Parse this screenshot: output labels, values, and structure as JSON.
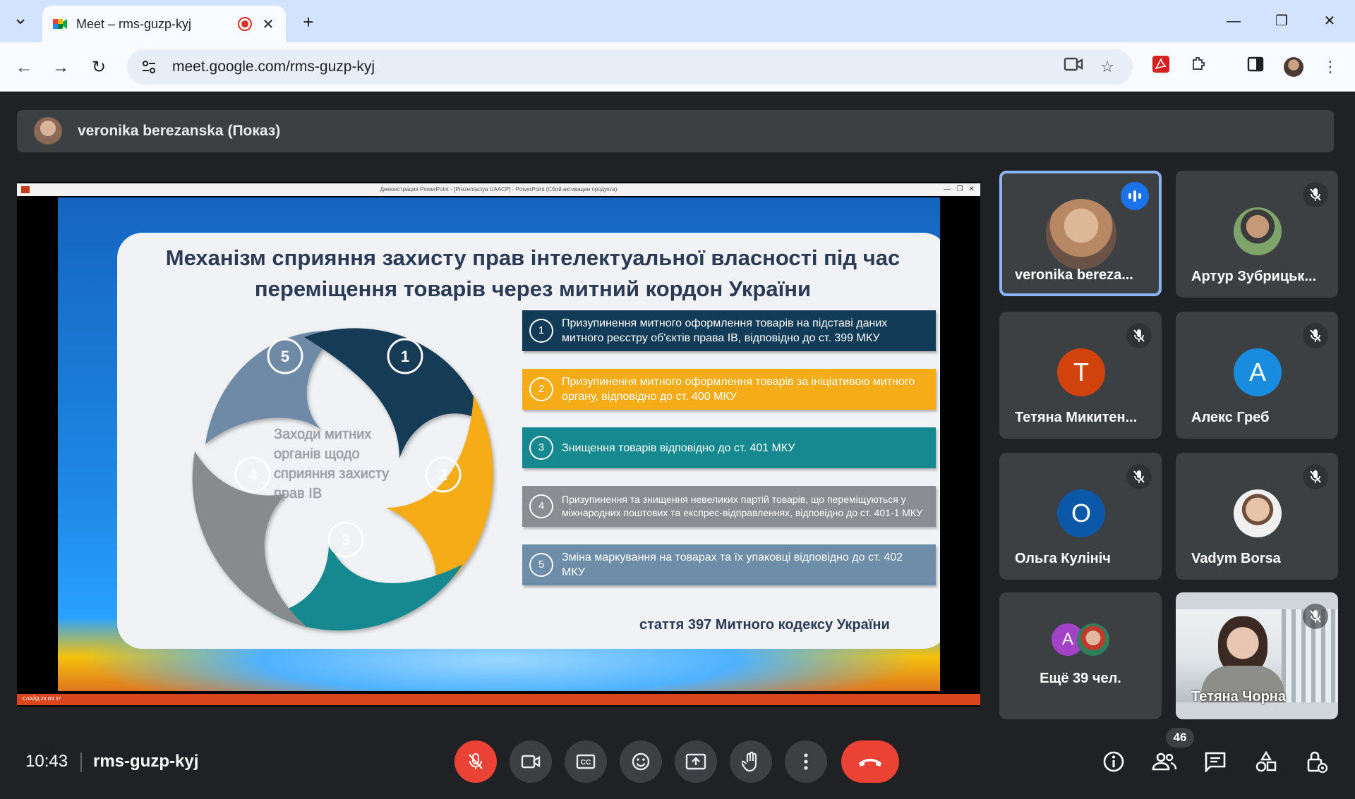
{
  "browser": {
    "tab_title": "Meet – rms-guzp-kyj",
    "url": "meet.google.com/rms-guzp-kyj"
  },
  "banner": {
    "presenter": "veronika berezanska (Показ)"
  },
  "slide": {
    "window_title": "Демонстрация PowerPoint - [Prezentaciya UAACP] - PowerPoint (Сбой активации продукта)",
    "title_line1": "Механізм сприяння захисту прав інтелектуальної власності під час",
    "title_line2": "переміщення товарів через митний кордон України",
    "cycle_center": "Заходи митних органів щодо сприяння захисту прав ІВ",
    "cycle_numbers": [
      "1",
      "2",
      "3",
      "4",
      "5"
    ],
    "items": [
      {
        "num": "1",
        "text": "Призупинення митного оформлення товарів на підставі даних митного реєстру об'єктів права ІВ, відповідно до ст. 399 МКУ",
        "color": "#123b57"
      },
      {
        "num": "2",
        "text": "Призупинення митного оформлення товарів за ініціативою митного органу, відповідно до ст. 400 МКУ",
        "color": "#f6ac16"
      },
      {
        "num": "3",
        "text": "Знищення товарів відповідно до ст. 401 МКУ",
        "color": "#16888f"
      },
      {
        "num": "4",
        "text": "Призупинення та знищення невеликих партій товарів, що переміщуються у міжнародних поштових та експрес-відправленнях, відповідно до ст. 401-1 МКУ",
        "color": "#8a8d91"
      },
      {
        "num": "5",
        "text": "Зміна маркування на товарах та їх упаковці відповідно до ст. 402 МКУ",
        "color": "#6d8da9"
      }
    ],
    "citation": "стаття 397 Митного кодексу України",
    "status_text": "СЛАЙД 28 ИЗ 37"
  },
  "participants": [
    {
      "name": "veronika bereza...",
      "avatar": "photo",
      "state": "speaking"
    },
    {
      "name": "Артур Зубрицьк...",
      "avatar": "photo",
      "state": "muted"
    },
    {
      "name": "Тетяна Микитен...",
      "initial": "T",
      "color": "#d2420d",
      "state": "muted"
    },
    {
      "name": "Алекс Греб",
      "initial": "A",
      "color": "#1a8ce0",
      "state": "muted"
    },
    {
      "name": "Ольга Кулініч",
      "initial": "O",
      "color": "#0b57a8",
      "state": "muted"
    },
    {
      "name": "Vadym Borsa",
      "avatar": "photo",
      "state": "muted"
    },
    {
      "name": "Ещё 39 чел.",
      "initial": "A",
      "color": "#a142c7"
    },
    {
      "name": "Тетяна Чорна",
      "avatar": "video",
      "state": "muted"
    }
  ],
  "bottom": {
    "time": "10:43",
    "meeting_code": "rms-guzp-kyj",
    "people_count": "46"
  },
  "colors": {
    "leave_red": "#ea4335",
    "active_tile_border": "#8ab4f8",
    "meet_bg": "#202124"
  }
}
